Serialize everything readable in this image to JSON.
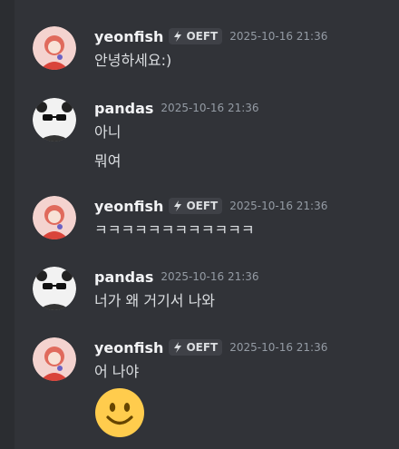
{
  "messages": [
    {
      "username": "yeonfish",
      "tag": "OEFT",
      "timestamp": "2025-10-16 21:36",
      "lines": [
        "안녕하세요:)"
      ]
    },
    {
      "username": "pandas",
      "timestamp": "2025-10-16 21:36",
      "lines": [
        "아니",
        "뭐여"
      ]
    },
    {
      "username": "yeonfish",
      "tag": "OEFT",
      "timestamp": "2025-10-16 21:36",
      "lines": [
        "ㅋㅋㅋㅋㅋㅋㅋㅋㅋㅋㅋㅋ"
      ]
    },
    {
      "username": "pandas",
      "timestamp": "2025-10-16 21:36",
      "lines": [
        "너가 왜 거기서 나와"
      ]
    },
    {
      "username": "yeonfish",
      "tag": "OEFT",
      "timestamp": "2025-10-16 21:36",
      "lines": [
        "어 나야"
      ],
      "emoji": "slightly-smiling-face"
    }
  ],
  "colors": {
    "background": "#313338",
    "username": "#f2f3f5",
    "timestamp": "#949ba4",
    "tag_background": "#3f4147"
  }
}
